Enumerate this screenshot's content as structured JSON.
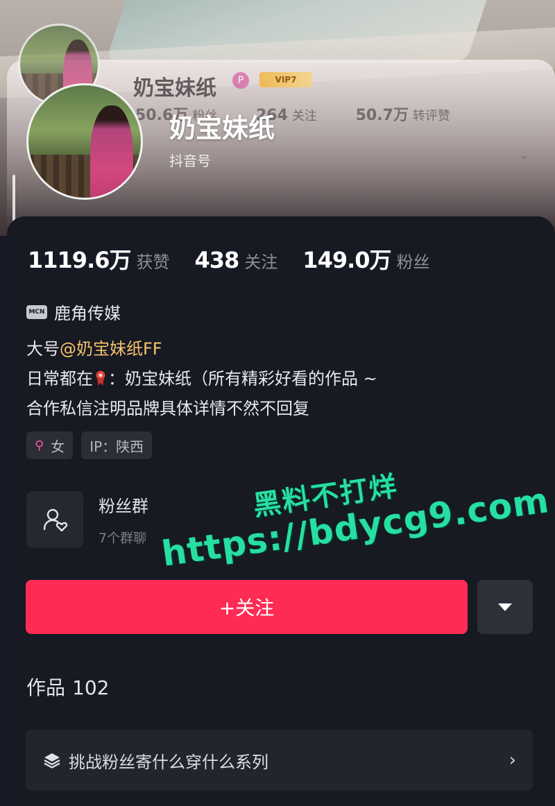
{
  "ghost_header": {
    "name": "奶宝妹纸",
    "badge": "P",
    "vip": "VIP7",
    "stats": [
      {
        "value": "50.6万",
        "label": "粉丝"
      },
      {
        "value": "264",
        "label": "关注"
      },
      {
        "value": "50.7万",
        "label": "转评赞"
      }
    ]
  },
  "profile": {
    "name": "奶宝妹纸",
    "douyin_id": "抖音号"
  },
  "stats": [
    {
      "value": "1119.6万",
      "label": "获赞"
    },
    {
      "value": "438",
      "label": "关注"
    },
    {
      "value": "149.0万",
      "label": "粉丝"
    }
  ],
  "mcn": {
    "icon_text": "MCN",
    "name": "鹿角传媒"
  },
  "bio": {
    "line1_prefix": "大号",
    "line1_mention": "@奶宝妹纸FF",
    "line2_prefix": "日常都在",
    "line2_suffix": "：奶宝妹纸（所有精彩好看的作品 ~",
    "line3": "合作私信注明品牌具体详情不然不回复"
  },
  "tags": {
    "gender_icon": "female-symbol",
    "gender": "女",
    "ip": "IP：陕西"
  },
  "fans_group": {
    "title": "粉丝群",
    "subtitle": "7个群聊"
  },
  "watermark": {
    "line1": "黑料不打烊",
    "line2": "https://bdycg9.com"
  },
  "actions": {
    "follow_label": "+关注",
    "accent_color": "#fe2c55"
  },
  "works": {
    "label": "作品",
    "count": "102"
  },
  "collection": {
    "label": "挑战粉丝寄什么穿什么系列",
    "arrow": "›"
  }
}
